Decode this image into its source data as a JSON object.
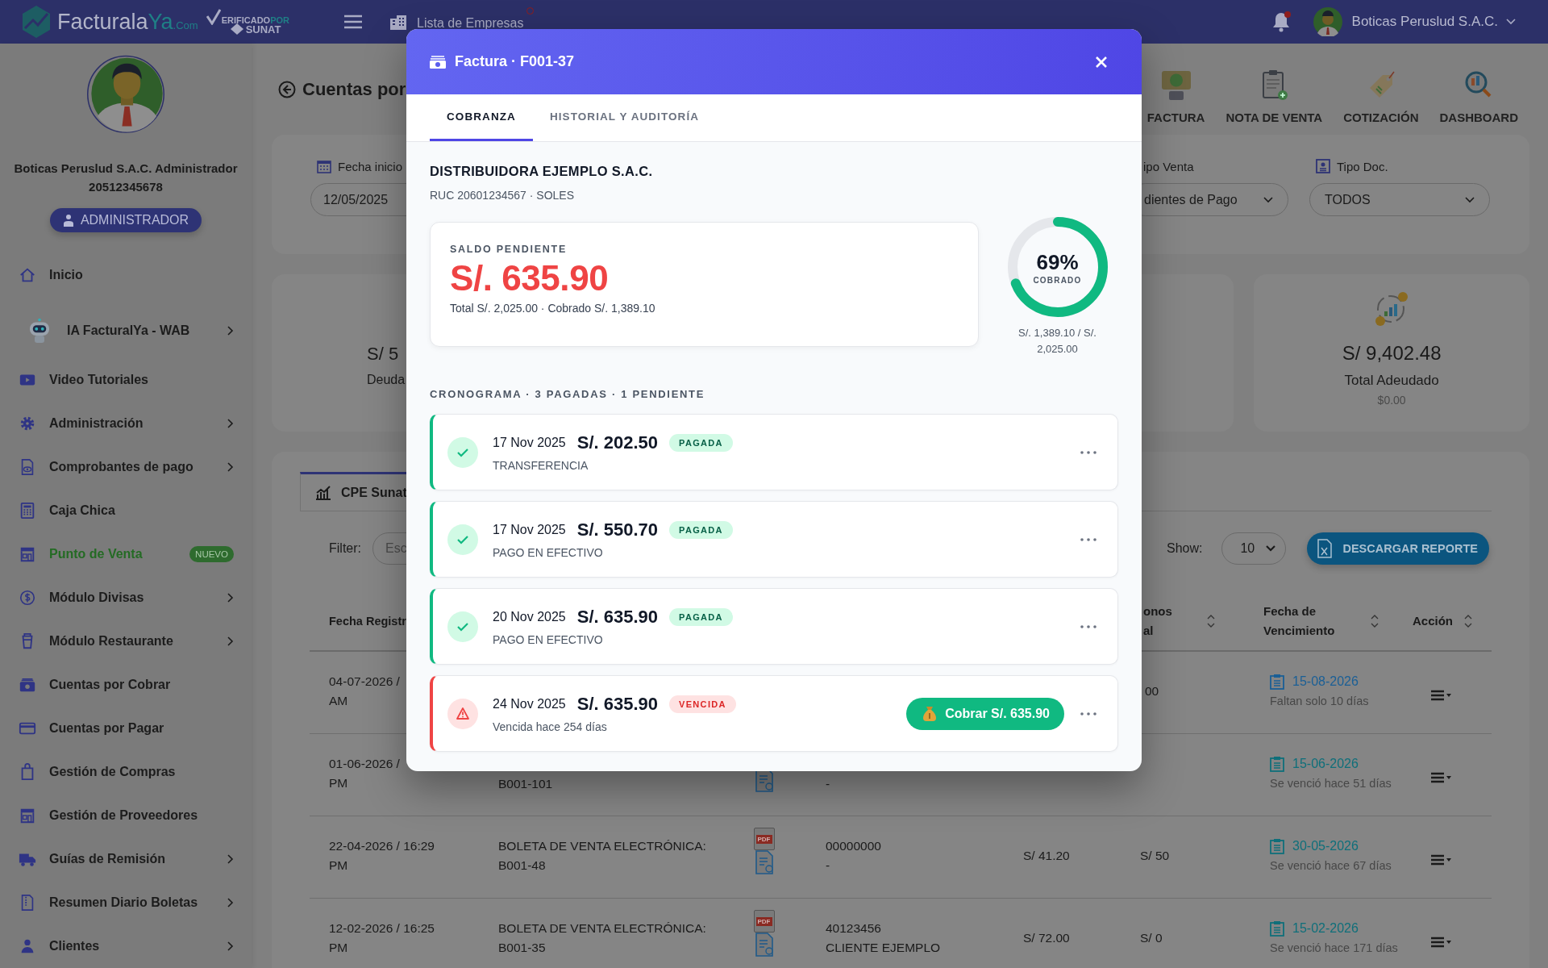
{
  "topbar": {
    "logo": {
      "main": "Facturala",
      "accent": "Ya",
      "suffix": ".Com"
    },
    "verified": {
      "text": "ERIFICADO",
      "accent": "POR",
      "authority": "SUNAT"
    },
    "company_switch": "Lista de Empresas",
    "notifications": {
      "unread": true
    },
    "user": "Boticas Peruslud S.A.C."
  },
  "sidebar": {
    "profile": {
      "name": "Boticas Peruslud S.A.C. Administrador",
      "ruc": "20512345678",
      "role": "ADMINISTRADOR"
    },
    "items": [
      {
        "label": "Inicio",
        "submenu": false,
        "featured": false
      },
      {
        "label": "IA FacturalYa - WAB",
        "submenu": true,
        "featured": false
      },
      {
        "label": "Video Tutoriales",
        "submenu": false,
        "featured": false
      },
      {
        "label": "Administración",
        "submenu": true,
        "featured": false
      },
      {
        "label": "Comprobantes de pago",
        "submenu": true,
        "featured": false
      },
      {
        "label": "Caja Chica",
        "submenu": false,
        "featured": false
      },
      {
        "label": "Punto de Venta",
        "submenu": false,
        "featured": true,
        "badge": "NUEVO"
      },
      {
        "label": "Módulo Divisas",
        "submenu": true,
        "featured": false
      },
      {
        "label": "Módulo Restaurante",
        "submenu": true,
        "featured": false
      },
      {
        "label": "Cuentas por Cobrar",
        "submenu": false,
        "featured": false
      },
      {
        "label": "Cuentas por Pagar",
        "submenu": false,
        "featured": false
      },
      {
        "label": "Gestión de Compras",
        "submenu": false,
        "featured": false
      },
      {
        "label": "Gestión de Proveedores",
        "submenu": false,
        "featured": false
      },
      {
        "label": "Guías de Remisión",
        "submenu": true,
        "featured": false
      },
      {
        "label": "Resumen Diario Boletas",
        "submenu": true,
        "featured": false
      },
      {
        "label": "Clientes",
        "submenu": true,
        "featured": false
      }
    ]
  },
  "page": {
    "title": "Cuentas por",
    "quick_actions": [
      "FACTURA",
      "NOTA DE VENTA",
      "COTIZACIÓN",
      "DASHBOARD"
    ]
  },
  "filters": {
    "start_label": "Fecha inicio",
    "start_value": "12/05/2025",
    "type_label": "ipo Venta",
    "type_value": "dientes de Pago",
    "doc_label": "Tipo Doc.",
    "doc_value": "TODOS"
  },
  "stats": [
    {
      "value": "S/ 5",
      "label": "Deuda"
    },
    {
      "value": "S/ 9,402.48",
      "label": "Total Adeudado",
      "note": "$0.00"
    }
  ],
  "table": {
    "tab": "CPE Sunat",
    "filter_label": "Filter:",
    "filter_placeholder": "Esc",
    "show_label": "Show:",
    "show_value": "10",
    "export": "DESCARGAR REPORTE",
    "columns": [
      {
        "label": "Fecha Registr"
      },
      {
        "label": "onos al",
        "sortable": true
      },
      {
        "label": "Fecha de Vencimiento",
        "sortable": true
      },
      {
        "label": "Acción",
        "sortable": true
      }
    ],
    "rows": [
      {
        "registered": [
          "04-07-2026 /",
          "AM"
        ],
        "paid": "00",
        "due_date": "15-08-2026",
        "overdue": false,
        "due_note": "Faltan solo 10 días"
      },
      {
        "registered": [
          "01-06-2026 /",
          "PM"
        ],
        "document": [
          "B001-101"
        ],
        "client": [
          "-"
        ],
        "due_date": "15-06-2026",
        "overdue": true,
        "due_note": "Se venció hace 51 días"
      },
      {
        "registered": [
          "22-04-2026 / 16:29",
          "PM"
        ],
        "document": [
          "BOLETA DE VENTA ELECTRÓNICA:",
          "B001-48"
        ],
        "file_badge": "PDF",
        "client": [
          "00000000",
          "-"
        ],
        "total": "S/ 41.20",
        "paid": "S/ 50",
        "due_date": "30-05-2026",
        "overdue": true,
        "due_note": "Se venció hace 67 días"
      },
      {
        "registered": [
          "12-02-2026 / 16:25",
          "PM"
        ],
        "document": [
          "BOLETA DE VENTA ELECTRÓNICA:",
          "B001-35"
        ],
        "file_badge": "PDF",
        "client": [
          "40123456",
          "CLIENTE EJEMPLO"
        ],
        "total": "S/ 72.00",
        "paid": "S/ 0",
        "due_date": "15-02-2026",
        "overdue": true,
        "due_note": "Se venció hace 171 días"
      }
    ]
  },
  "modal": {
    "title": "Factura · F001-37",
    "tabs": [
      {
        "label": "COBRANZA",
        "selected": true
      },
      {
        "label": "HISTORIAL Y AUDITORÍA",
        "selected": false
      }
    ],
    "customer": "DISTRIBUIDORA EJEMPLO S.A.C.",
    "customer_meta": "RUC 20601234567 · SOLES",
    "balance": {
      "label": "SALDO PENDIENTE",
      "amount": "S/. 635.90",
      "detail": "Total S/. 2,025.00 · Cobrado S/. 1,389.10"
    },
    "progress": {
      "level": 0.69,
      "percent": "69%",
      "caption": "COBRADO",
      "detail": "S/. 1,389.10 / S/. 2,025.00"
    },
    "schedule_title": "CRONOGRAMA · 3 PAGADAS · 1 PENDIENTE",
    "installments": [
      {
        "kind": "paid",
        "date": "17 Nov 2025",
        "amount": "S/. 202.50",
        "badge": "PAGADA",
        "note": "TRANSFERENCIA"
      },
      {
        "kind": "paid",
        "date": "17 Nov 2025",
        "amount": "S/. 550.70",
        "badge": "PAGADA",
        "note": "PAGO EN EFECTIVO"
      },
      {
        "kind": "paid",
        "date": "20 Nov 2025",
        "amount": "S/. 635.90",
        "badge": "PAGADA",
        "note": "PAGO EN EFECTIVO"
      },
      {
        "kind": "overdue",
        "date": "24 Nov 2025",
        "amount": "S/. 635.90",
        "badge": "VENCIDA",
        "note": "Vencida hace 254 días",
        "action": "Cobrar S/. 635.90"
      }
    ]
  }
}
